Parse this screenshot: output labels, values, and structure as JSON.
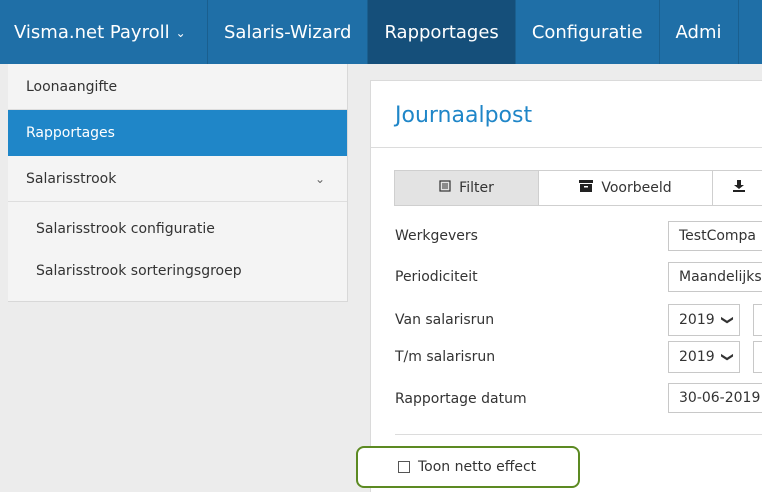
{
  "nav": {
    "brand": "Visma.net Payroll",
    "items": [
      {
        "label": "Salaris-Wizard",
        "active": false
      },
      {
        "label": "Rapportages",
        "active": true
      },
      {
        "label": "Configuratie",
        "active": false
      },
      {
        "label": "Admi",
        "active": false
      }
    ]
  },
  "sidebar": {
    "items": [
      {
        "label": "Loonaangifte"
      },
      {
        "label": "Rapportages"
      },
      {
        "label": "Salarisstrook"
      }
    ],
    "subitems": [
      {
        "label": "Salarisstrook configuratie"
      },
      {
        "label": "Salarisstrook sorteringsgroep"
      }
    ]
  },
  "panel": {
    "title": "Journaalpost",
    "tabs": [
      {
        "label": "Filter",
        "icon": "filter-icon"
      },
      {
        "label": "Voorbeeld",
        "icon": "archive-icon"
      },
      {
        "label": "",
        "icon": "download-icon"
      }
    ],
    "fields": {
      "werkgevers": {
        "label": "Werkgevers",
        "value": "TestCompa"
      },
      "periodiciteit": {
        "label": "Periodiciteit",
        "value": "Maandelijks"
      },
      "van": {
        "label": "Van salarisrun",
        "value": "2019"
      },
      "tm": {
        "label": "T/m salarisrun",
        "value": "2019"
      },
      "datum": {
        "label": "Rapportage datum",
        "value": "30-06-2019"
      }
    },
    "checkbox": {
      "label": "Toon netto effect",
      "checked": false
    }
  },
  "colors": {
    "nav": "#1f6fa7",
    "accent": "#1f86c8",
    "highlight": "#5c8a22"
  }
}
